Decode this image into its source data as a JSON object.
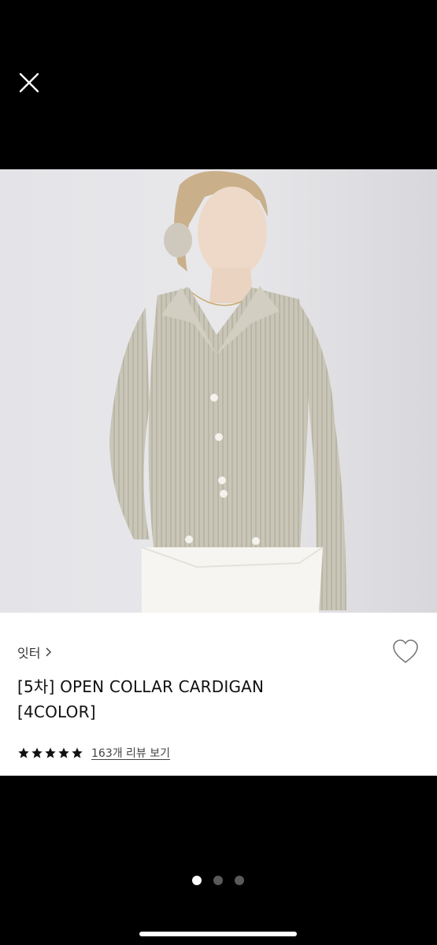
{
  "product": {
    "brand": "잇터",
    "title_line1": "[5차] OPEN COLLAR CARDIGAN",
    "title_line2": "[4COLOR]",
    "review_link": "163개 리뷰 보기",
    "rating": 5,
    "rating_max": 5
  },
  "carousel": {
    "current": 1,
    "total": 3
  },
  "icons": {
    "close": "close-icon",
    "heart": "heart-icon",
    "chevron": "chevron-right-icon",
    "star": "star-icon"
  },
  "colors": {
    "background": "#000000",
    "panel": "#ffffff",
    "text": "#111111"
  }
}
